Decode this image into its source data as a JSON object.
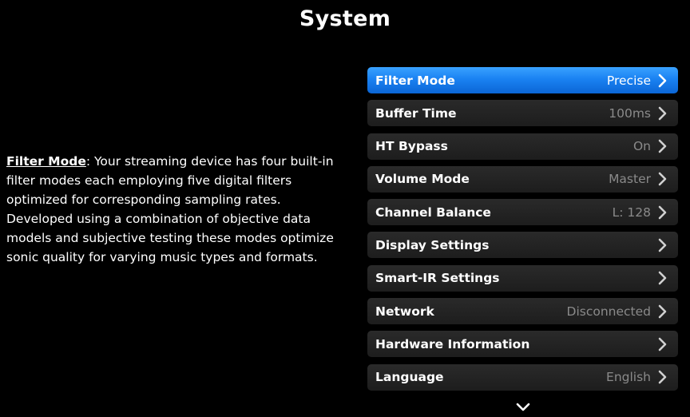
{
  "header": {
    "title": "System"
  },
  "description": {
    "term": "Filter Mode",
    "text": ": Your streaming device has four built-in filter modes each employing five digital filters optimized for corresponding sampling rates. Developed using a combination of objective data models and subjective testing these modes optimize sonic quality for varying music types and formats."
  },
  "menu": {
    "items": [
      {
        "label": "Filter Mode",
        "value": "Precise",
        "active": true
      },
      {
        "label": "Buffer Time",
        "value": "100ms"
      },
      {
        "label": "HT Bypass",
        "value": "On"
      },
      {
        "label": "Volume Mode",
        "value": "Master"
      },
      {
        "label": "Channel Balance",
        "value": "L: 128"
      },
      {
        "label": "Display Settings",
        "value": ""
      },
      {
        "label": "Smart-IR Settings",
        "value": ""
      },
      {
        "label": "Network",
        "value": "Disconnected"
      },
      {
        "label": "Hardware Information",
        "value": ""
      },
      {
        "label": "Language",
        "value": "English"
      }
    ]
  },
  "icons": {
    "item_arrow": "chevron-right-icon",
    "scroll_indicator": "chevron-down-icon"
  },
  "colors": {
    "background": "#000000",
    "active_item": "#1a82f2",
    "item_background": "#262626",
    "value_text": "#8a8a8a"
  }
}
